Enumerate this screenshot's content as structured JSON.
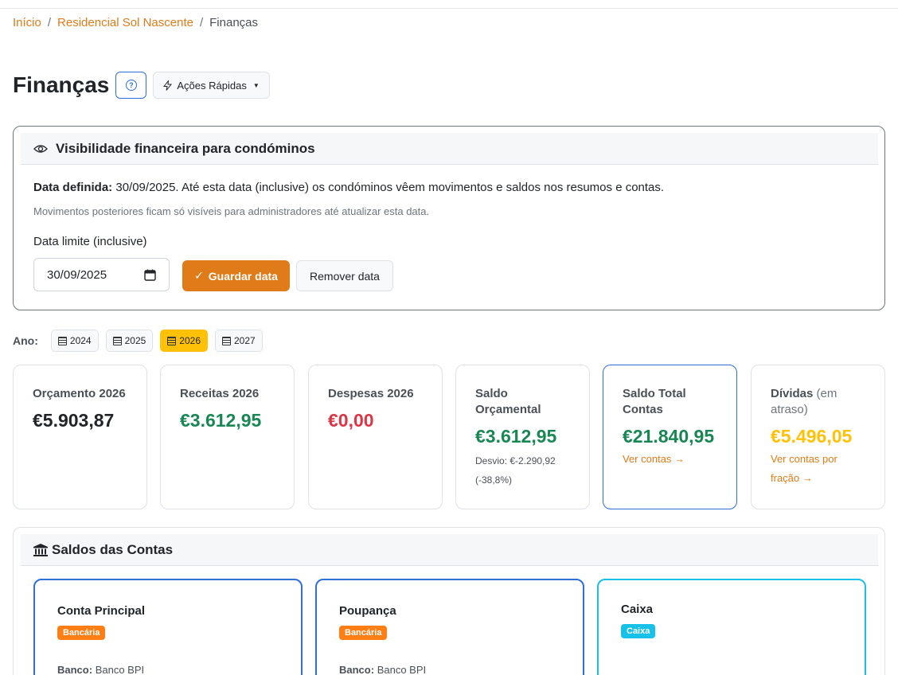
{
  "breadcrumb": {
    "home": "Início",
    "condo": "Residencial Sol Nascente",
    "current": "Finanças"
  },
  "header": {
    "title": "Finanças",
    "help_symbol": "?",
    "quick_actions": "Ações Rápidas"
  },
  "visibility": {
    "title": "Visibilidade financeira para condóminos",
    "defined_label": "Data definida:",
    "defined_text": "30/09/2025. Até esta data (inclusive) os condóminos vêem movimentos e saldos nos resumos e contas.",
    "note": "Movimentos posteriores ficam só visíveis para administradores até atualizar esta data.",
    "limit_label": "Data limite (inclusive)",
    "date_value": "30/09/2025",
    "save_label": "Guardar data",
    "remove_label": "Remover data"
  },
  "years": {
    "label": "Ano:",
    "items": [
      "2024",
      "2025",
      "2026",
      "2027"
    ],
    "active": "2026"
  },
  "stats": {
    "budget": {
      "label": "Orçamento 2026",
      "value": "€5.903,87"
    },
    "income": {
      "label": "Receitas 2026",
      "value": "€3.612,95"
    },
    "expenses": {
      "label": "Despesas 2026",
      "value": "€0,00"
    },
    "balance": {
      "label": "Saldo Orçamental",
      "value": "€3.612,95",
      "deviation": "Desvio: €-2.290,92 (-38,8%)"
    },
    "total": {
      "label": "Saldo Total Contas",
      "value": "€21.840,95",
      "link": "Ver contas →"
    },
    "debts": {
      "label": "Dívidas",
      "label_muted": "(em atraso)",
      "value": "€5.496,05",
      "link": "Ver contas por fração →"
    }
  },
  "accounts": {
    "title": "Saldos das Contas",
    "items": [
      {
        "name": "Conta Principal",
        "badge": "Bancária",
        "bank_label": "Banco:",
        "bank": "Banco BPI"
      },
      {
        "name": "Poupança",
        "badge": "Bancária",
        "bank_label": "Banco:",
        "bank": "Banco BPI"
      },
      {
        "name": "Caixa",
        "badge": "Caixa"
      }
    ]
  },
  "colors": {
    "accent": "#e07b1a",
    "primary": "#2f6fdb",
    "success": "#198754",
    "danger": "#dc3545",
    "warning": "#ffc107",
    "info": "#17c1e8"
  }
}
